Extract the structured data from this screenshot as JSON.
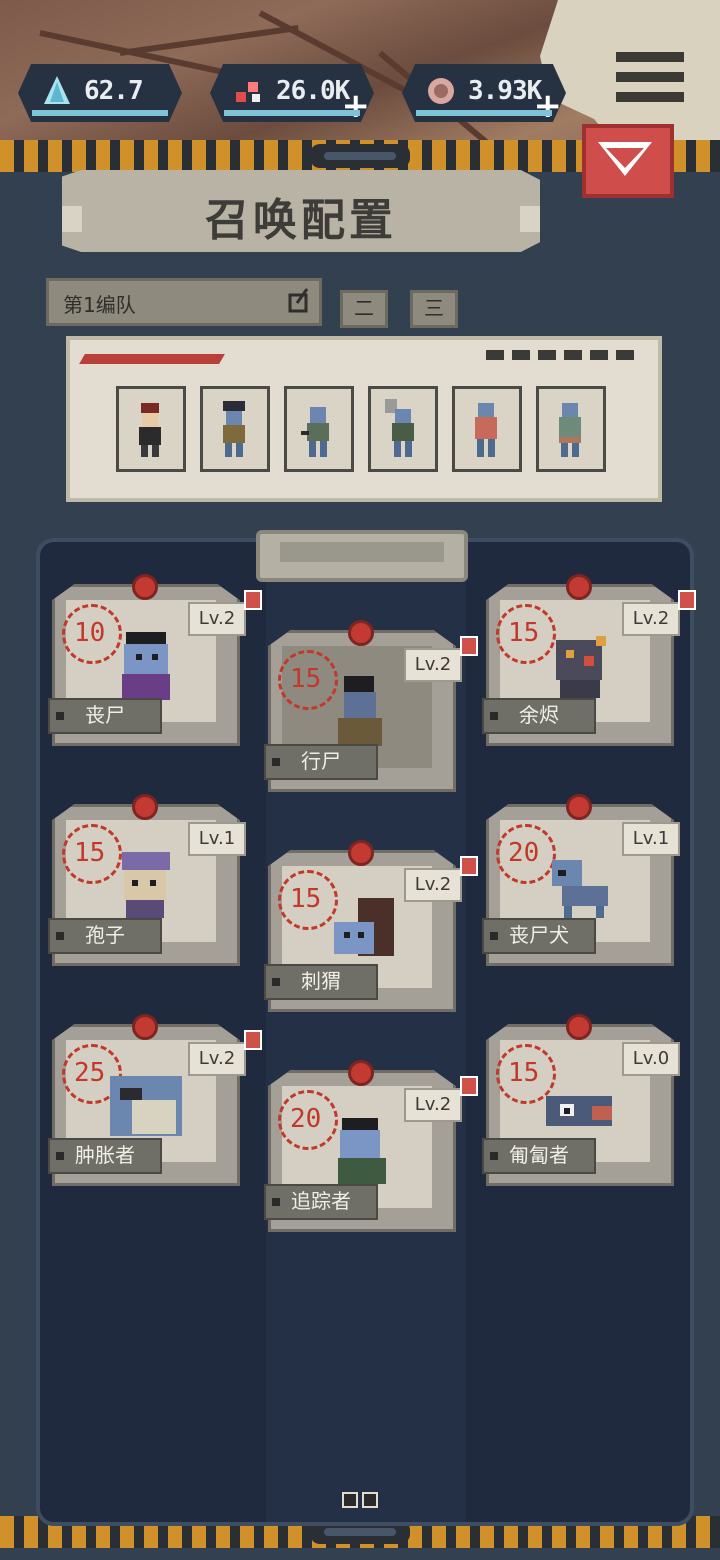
{
  "resources": [
    {
      "name": "crystal",
      "icon": "crystal-icon",
      "value": "62.7",
      "plus": false
    },
    {
      "name": "flesh",
      "icon": "flesh-icon",
      "value": "26.0K",
      "plus": true
    },
    {
      "name": "bone",
      "icon": "bone-icon",
      "value": "3.93K",
      "plus": true
    }
  ],
  "header": {
    "title": "召唤配置"
  },
  "team": {
    "selected": "第1编队",
    "tabs": [
      "二",
      "三"
    ]
  },
  "formation": {
    "slot_count": 6
  },
  "cards": [
    {
      "name": "丧尸",
      "cost": "10",
      "level": "Lv.2",
      "alert": true,
      "selected": false
    },
    {
      "name": "行尸",
      "cost": "15",
      "level": "Lv.2",
      "alert": true,
      "selected": true
    },
    {
      "name": "余烬",
      "cost": "15",
      "level": "Lv.2",
      "alert": true,
      "selected": false
    },
    {
      "name": "孢子",
      "cost": "15",
      "level": "Lv.1",
      "alert": false,
      "selected": false
    },
    {
      "name": "刺猬",
      "cost": "15",
      "level": "Lv.2",
      "alert": true,
      "selected": false
    },
    {
      "name": "丧尸犬",
      "cost": "20",
      "level": "Lv.1",
      "alert": false,
      "selected": false
    },
    {
      "name": "肿胀者",
      "cost": "25",
      "level": "Lv.2",
      "alert": true,
      "selected": false
    },
    {
      "name": "追踪者",
      "cost": "20",
      "level": "Lv.2",
      "alert": true,
      "selected": false
    },
    {
      "name": "匍匐者",
      "cost": "15",
      "level": "Lv.0",
      "alert": false,
      "selected": false
    }
  ],
  "colors": {
    "accent_red": "#c0392b",
    "hazard": "#d0902a",
    "panel": "#33404f",
    "board": "#1f2a3f"
  }
}
